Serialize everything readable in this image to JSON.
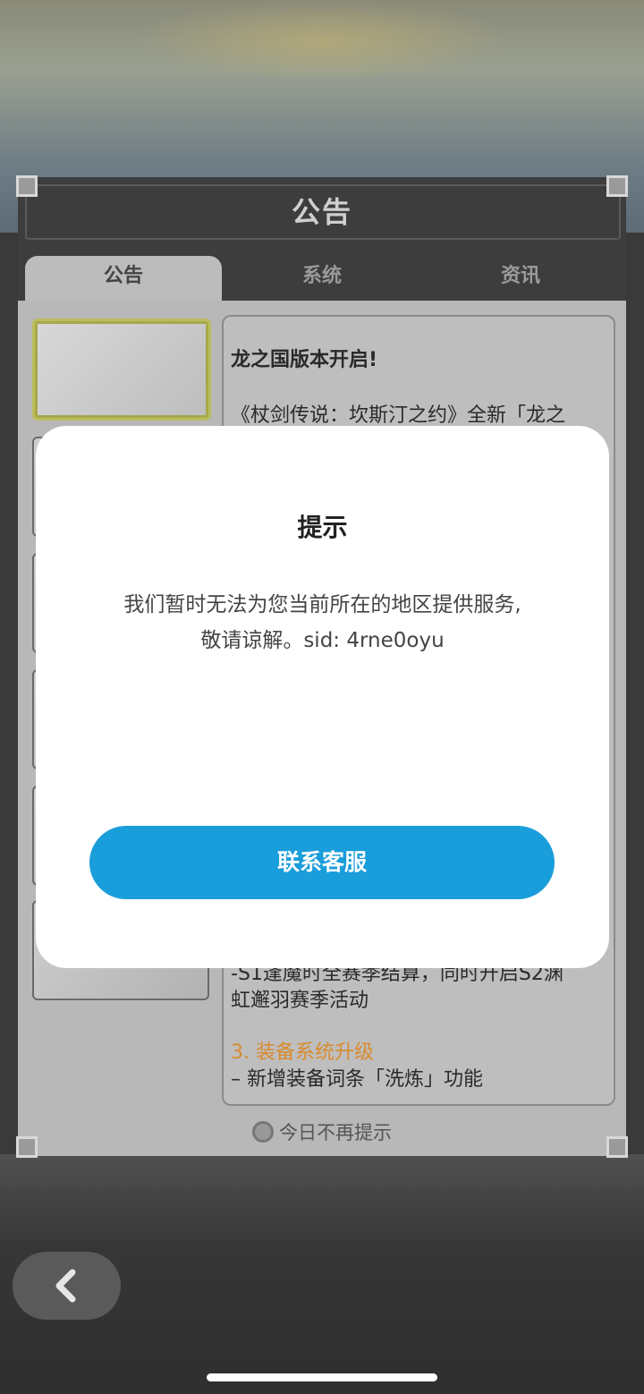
{
  "panel": {
    "title": "公告",
    "tabs": [
      {
        "label": "公告",
        "active": true
      },
      {
        "label": "系统",
        "active": false
      },
      {
        "label": "资讯",
        "active": false
      }
    ],
    "article": {
      "heading": "龙之国版本开启!",
      "intro": "《杖剑传说：坎斯汀之约》全新「龙之",
      "line_partial_1": "-S1逢魔时全赛季结算，同时开启S2渊",
      "line_partial_2": "虹邂羽赛季活动",
      "section_title": "3. 装备系统升级",
      "section_item": "– 新增装备词条「洗炼」功能"
    },
    "dont_show_today": "今日不再提示"
  },
  "modal": {
    "title": "提示",
    "message_line1": "我们暂时无法为您当前所在的地区提供服务,",
    "message_line2": "敬请谅解。sid: 4rne0oyu",
    "button_label": "联系客服"
  },
  "colors": {
    "accent_blue": "#1a9ddb",
    "section_orange": "#e8952e"
  },
  "icons": {
    "back": "chevron-left-icon"
  }
}
